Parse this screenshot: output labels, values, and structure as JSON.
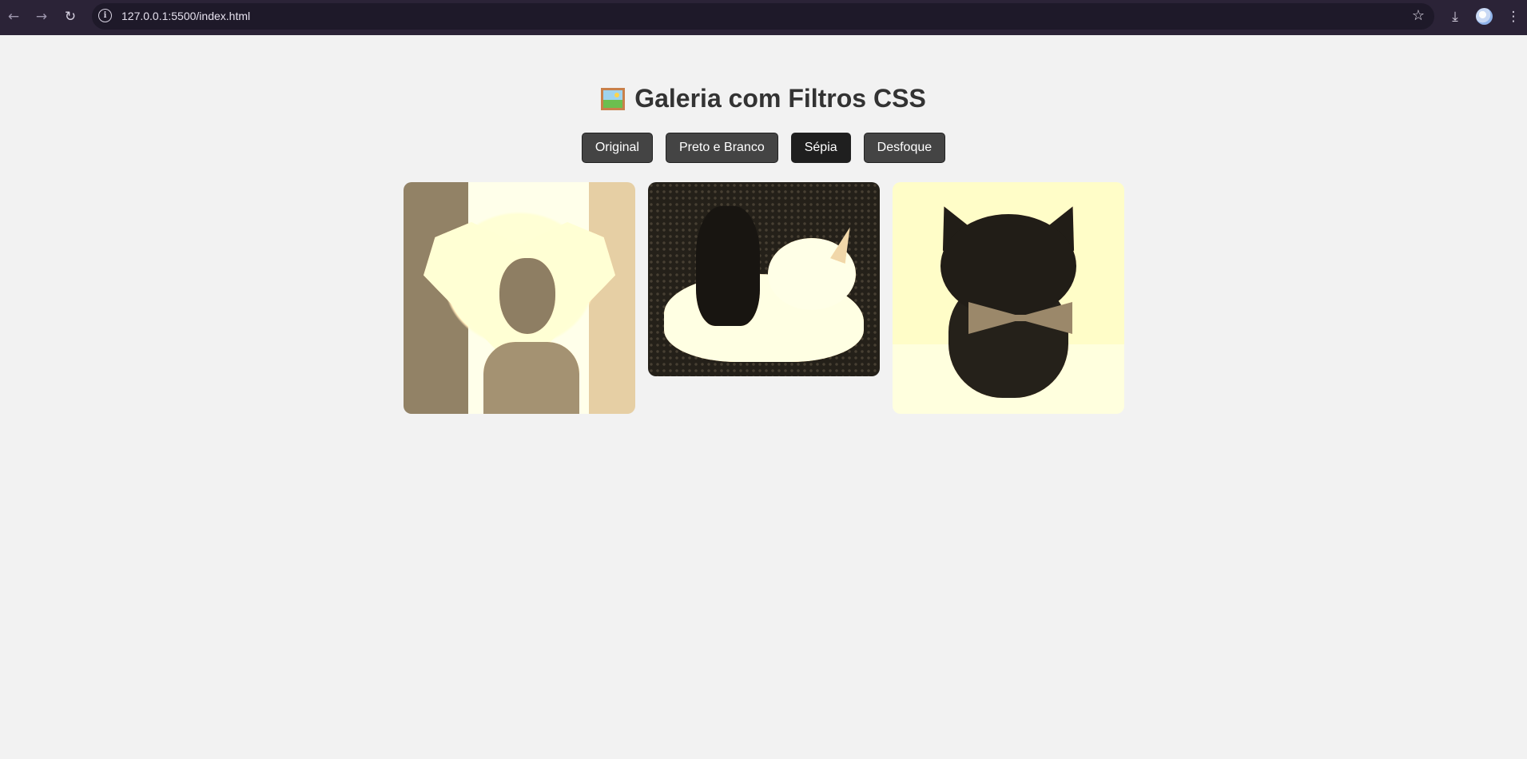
{
  "browser": {
    "url": "127.0.0.1:5500/index.html",
    "back_icon": "←",
    "forward_icon": "→",
    "reload_icon": "↻",
    "info_icon": "i",
    "star_icon": "☆",
    "download_icon": "⤓",
    "menu_icon": "⋮"
  },
  "page": {
    "title": "Galeria com Filtros CSS",
    "title_icon": "framed-picture-emoji"
  },
  "filters": {
    "active": "Sépia",
    "buttons": [
      {
        "label": "Original"
      },
      {
        "label": "Preto e Branco"
      },
      {
        "label": "Sépia"
      },
      {
        "label": "Desfoque"
      }
    ]
  },
  "gallery": {
    "filter_applied": "sepia",
    "images": [
      {
        "subject": "dog wearing heart-shaped cone"
      },
      {
        "subject": "black kitten on unicorn plush"
      },
      {
        "subject": "black kitten with bow"
      }
    ]
  }
}
